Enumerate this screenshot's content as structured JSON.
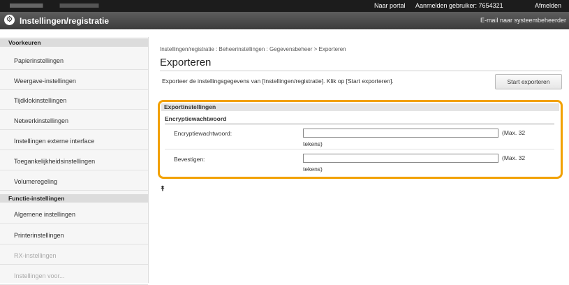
{
  "topbar": {
    "portal_link": "Naar portal",
    "user_label": "Aanmelden gebruiker: 7654321",
    "logout_link": "Afmelden"
  },
  "header": {
    "title": "Instellingen/registratie",
    "email_link": "E-mail naar systeembeheerder"
  },
  "sidebar": {
    "groups": [
      {
        "label": "Voorkeuren",
        "items": [
          "Papierinstellingen",
          "Weergave-instellingen",
          "Tijdklokinstellingen",
          "Netwerkinstellingen",
          "Instellingen externe interface",
          "Toegankelijkheidsinstellingen",
          "Volumeregeling"
        ]
      },
      {
        "label": "Functie-instellingen",
        "items": [
          "Algemene instellingen",
          "Printerinstellingen",
          "RX-instellingen",
          "Instellingen voor..."
        ]
      }
    ]
  },
  "main": {
    "breadcrumb": "Instellingen/registratie : Beheerinstellingen : Gegevensbeheer > Exporteren",
    "title": "Exporteren",
    "description": "Exporteer de instellingsgegevens van [Instellingen/registratie]. Klik op [Start exporteren].",
    "start_button": "Start exporteren",
    "section_title": "Exportinstellingen",
    "subsection_title": "Encryptiewachtwoord",
    "fields": [
      {
        "label": "Encryptiewachtwoord:",
        "value": "",
        "hint_a": "(Max. 32",
        "hint_b": "tekens)"
      },
      {
        "label": "Bevestigen:",
        "value": "",
        "hint_a": "(Max. 32",
        "hint_b": "tekens)"
      }
    ],
    "to_top": "⯭"
  },
  "colors": {
    "highlight": "#f2a100",
    "topbar": "#1c1c1c",
    "titlebar": "#4a4a4a"
  }
}
